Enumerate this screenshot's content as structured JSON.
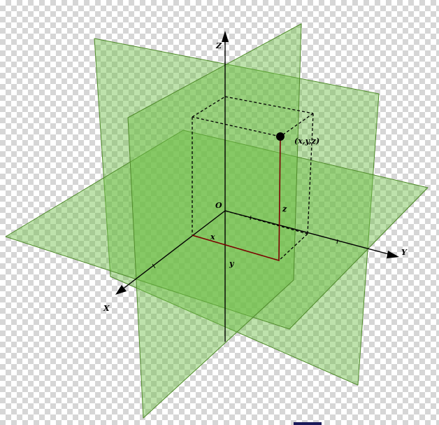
{
  "labels": {
    "axis_x": "X",
    "axis_y": "Y",
    "axis_z": "Z",
    "origin": "O",
    "point": "(x,y,z)",
    "coord_x": "x",
    "coord_y": "y",
    "coord_z": "z"
  },
  "colors": {
    "plane_fill": "#8fd16a",
    "plane_edge": "#4f8a2a",
    "projection_line": "#7a0000",
    "axis": "#000000"
  }
}
